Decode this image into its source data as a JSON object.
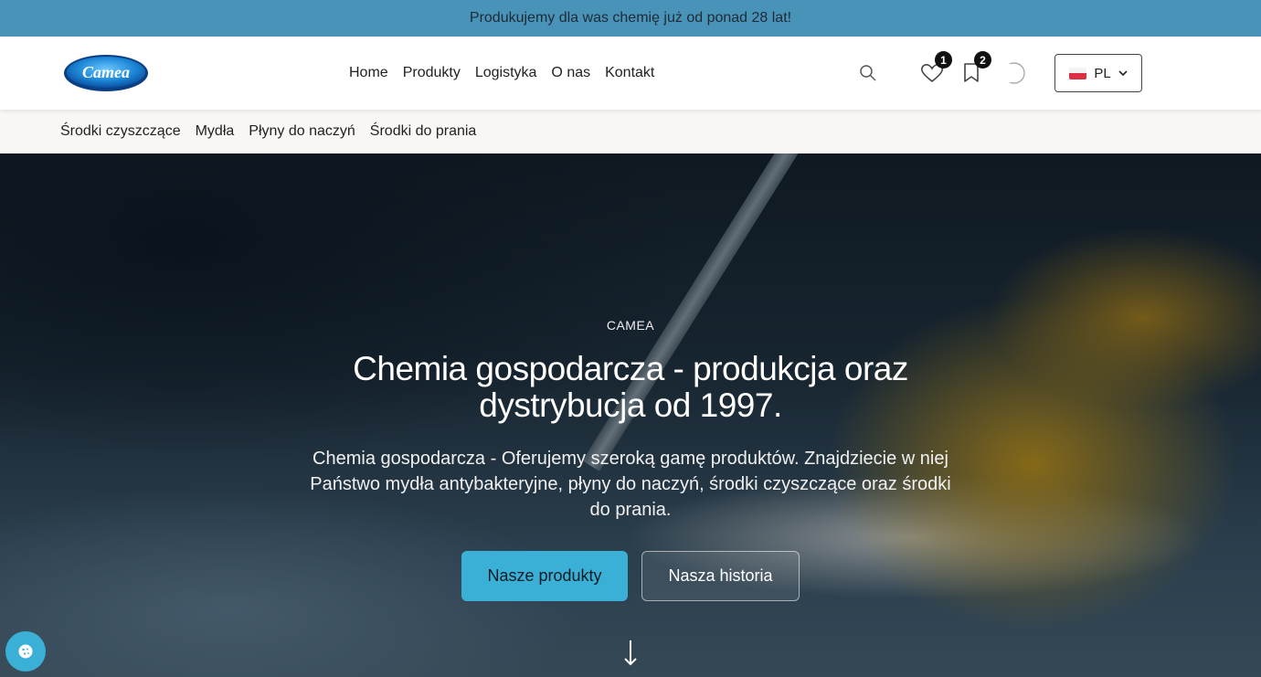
{
  "announcement": "Produkujemy dla was chemię już od ponad 28 lat!",
  "brand": {
    "logo_text": "Camea",
    "logo_color": "#1e88d8"
  },
  "main_nav": [
    {
      "label": "Home"
    },
    {
      "label": "Produkty"
    },
    {
      "label": "Logistyka"
    },
    {
      "label": "O nas"
    },
    {
      "label": "Kontakt"
    }
  ],
  "header_actions": {
    "search_icon": "search-icon",
    "wishlist_count": "1",
    "bookmarks_count": "2",
    "theme_icon": "moon-icon",
    "language": "PL"
  },
  "category_nav": [
    {
      "label": "Środki czyszczące"
    },
    {
      "label": "Mydła"
    },
    {
      "label": "Płyny do naczyń"
    },
    {
      "label": "Środki do prania"
    }
  ],
  "hero": {
    "eyebrow": "CAMEA",
    "title": "Chemia gospodarcza - produkcja oraz dystrybucja od 1997.",
    "lead": "Chemia gospodarcza - Oferujemy szeroką gamę produktów. Znajdziecie w niej Państwo mydła antybakteryjne, płyny do naczyń, środki czyszczące oraz środki do prania.",
    "primary_button": "Nasze produkty",
    "secondary_button": "Nasza historia"
  },
  "colors": {
    "topbar": "#4a93b8",
    "accent": "#3ab0d6"
  }
}
